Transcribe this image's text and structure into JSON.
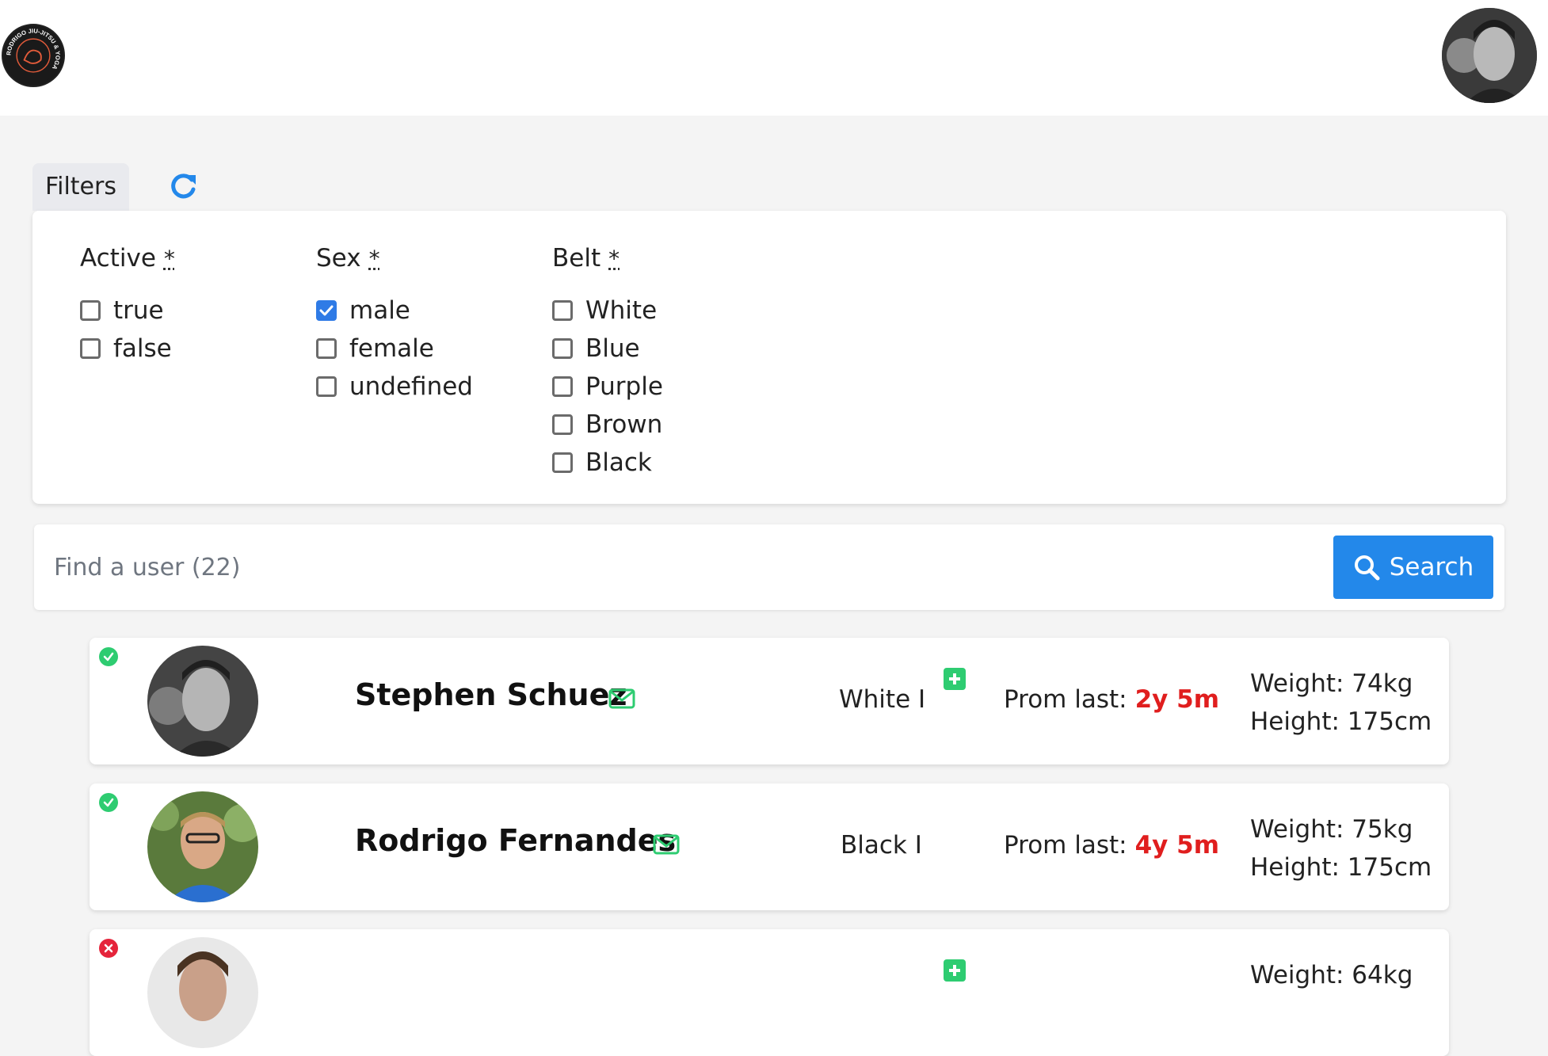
{
  "header": {
    "logo_text": "RODRIGO JIU-JITSU & YOGA"
  },
  "filters": {
    "tab_label": "Filters",
    "groups": [
      {
        "title": "Active",
        "required_mark": "*",
        "options": [
          {
            "label": "true",
            "checked": false
          },
          {
            "label": "false",
            "checked": false
          }
        ]
      },
      {
        "title": "Sex",
        "required_mark": "*",
        "options": [
          {
            "label": "male",
            "checked": true
          },
          {
            "label": "female",
            "checked": false
          },
          {
            "label": "undefined",
            "checked": false
          }
        ]
      },
      {
        "title": "Belt",
        "required_mark": "*",
        "options": [
          {
            "label": "White",
            "checked": false
          },
          {
            "label": "Blue",
            "checked": false
          },
          {
            "label": "Purple",
            "checked": false
          },
          {
            "label": "Brown",
            "checked": false
          },
          {
            "label": "Black",
            "checked": false
          }
        ]
      }
    ]
  },
  "search": {
    "placeholder": "Find a user (22)",
    "value": "",
    "button_label": "Search"
  },
  "users": [
    {
      "status": "active",
      "name": "Stephen Schuez",
      "belt": "White I",
      "promote_available": true,
      "prom_label": "Prom last:",
      "prom_value": "2y 5m",
      "weight": "Weight: 74kg",
      "height": "Height: 175cm"
    },
    {
      "status": "active",
      "name": "Rodrigo Fernandes",
      "belt": "Black I",
      "promote_available": false,
      "prom_label": "Prom last:",
      "prom_value": "4y 5m",
      "weight": "Weight: 75kg",
      "height": "Height: 175cm"
    },
    {
      "status": "inactive",
      "name": "",
      "belt": "",
      "promote_available": true,
      "prom_label": "",
      "prom_value": "",
      "weight": "Weight: 64kg",
      "height": ""
    }
  ],
  "colors": {
    "accent": "#2388ea",
    "checked": "#2f7be6",
    "success": "#2ecc71",
    "danger": "#e5243b",
    "prom_highlight": "#e01e1e"
  }
}
